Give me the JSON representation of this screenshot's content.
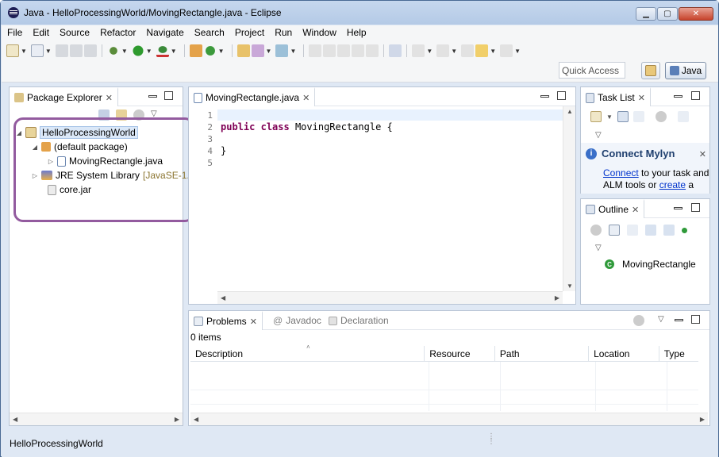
{
  "window": {
    "title": "Java - HelloProcessingWorld/MovingRectangle.java - Eclipse",
    "controls": {
      "minimize": "▁",
      "maximize": "▢",
      "close": "✕"
    }
  },
  "menu": [
    "File",
    "Edit",
    "Source",
    "Refactor",
    "Navigate",
    "Search",
    "Project",
    "Run",
    "Window",
    "Help"
  ],
  "toolbar": {
    "quick_access_placeholder": "Quick Access",
    "perspective_label": "Java"
  },
  "package_explorer": {
    "tab_label": "Package Explorer",
    "tree": [
      {
        "label": "HelloProcessingWorld",
        "kind": "project",
        "expanded": true
      },
      {
        "label": "(default package)",
        "kind": "package",
        "expanded": true
      },
      {
        "label": "MovingRectangle.java",
        "kind": "java-file",
        "expanded": false
      },
      {
        "label": "JRE System Library",
        "suffix": "[JavaSE-1.",
        "kind": "library",
        "expanded": false
      },
      {
        "label": "core.jar",
        "kind": "jar"
      }
    ]
  },
  "editor": {
    "tab_label": "MovingRectangle.java",
    "line_numbers": [
      "1",
      "2",
      "3",
      "4",
      "5"
    ],
    "code": {
      "line2_kw1": "public",
      "line2_kw2": "class",
      "line2_rest": " MovingRectangle {",
      "line4": "}"
    }
  },
  "task_list": {
    "tab_label": "Task List"
  },
  "mylyn": {
    "title": "Connect Mylyn",
    "link1": "Connect",
    "text1": " to your task and",
    "text2": "ALM tools or ",
    "link2": "create",
    "text3": " a"
  },
  "outline": {
    "tab_label": "Outline",
    "item": "MovingRectangle"
  },
  "bottom": {
    "tabs": {
      "problems": "Problems",
      "javadoc": "Javadoc",
      "declaration": "Declaration"
    },
    "count": "0 items",
    "columns": [
      "Description",
      "Resource",
      "Path",
      "Location",
      "Type"
    ]
  },
  "status": {
    "text": "HelloProcessingWorld"
  },
  "colors": {
    "accent_highlight": "#935b9f",
    "keyword": "#7f0055",
    "link": "#0033cc"
  }
}
